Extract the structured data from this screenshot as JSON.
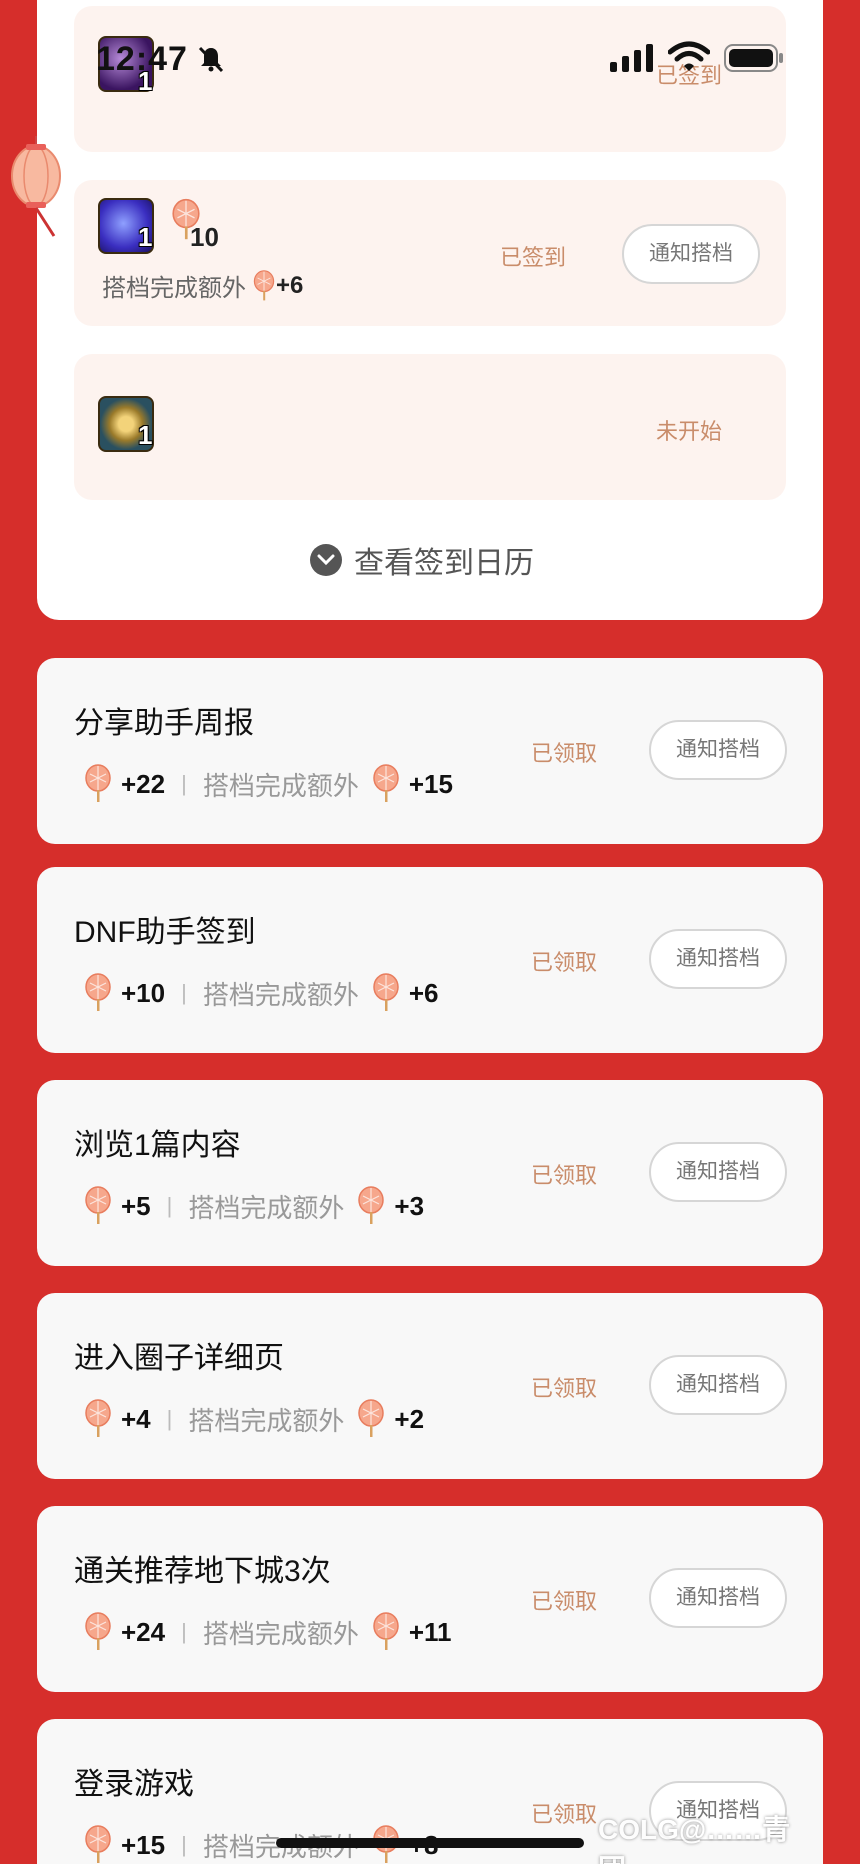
{
  "status_bar": {
    "time": "12:47"
  },
  "signin_rows": [
    {
      "item_count": "1",
      "status": "已签到"
    },
    {
      "item_count": "1",
      "coupon_count": "10",
      "status": "已签到",
      "button": "通知搭档",
      "extra_label": "搭档完成额外",
      "extra_points": "+6"
    },
    {
      "item_count": "1",
      "status": "未开始"
    }
  ],
  "calendar_link": "查看签到日历",
  "tasks": [
    {
      "title": "分享助手周报",
      "points": "+22",
      "extra_label": "搭档完成额外",
      "extra_points": "+15",
      "status": "已领取",
      "button": "通知搭档"
    },
    {
      "title": "DNF助手签到",
      "points": "+10",
      "extra_label": "搭档完成额外",
      "extra_points": "+6",
      "status": "已领取",
      "button": "通知搭档"
    },
    {
      "title": "浏览1篇内容",
      "points": "+5",
      "extra_label": "搭档完成额外",
      "extra_points": "+3",
      "status": "已领取",
      "button": "通知搭档"
    },
    {
      "title": "进入圈子详细页",
      "points": "+4",
      "extra_label": "搭档完成额外",
      "extra_points": "+2",
      "status": "已领取",
      "button": "通知搭档"
    },
    {
      "title": "通关推荐地下城3次",
      "points": "+24",
      "extra_label": "搭档完成额外",
      "extra_points": "+11",
      "status": "已领取",
      "button": "通知搭档"
    },
    {
      "title": "登录游戏",
      "points": "+15",
      "extra_label": "搭档完成额外",
      "extra_points": "+8",
      "status": "已领取",
      "button": "通知搭档"
    }
  ],
  "watermark": "COLG@……青团……",
  "colors": {
    "background": "#d62e2b",
    "card": "#ffffff",
    "row": "#fdf3ef",
    "status": "#c98c6a"
  }
}
